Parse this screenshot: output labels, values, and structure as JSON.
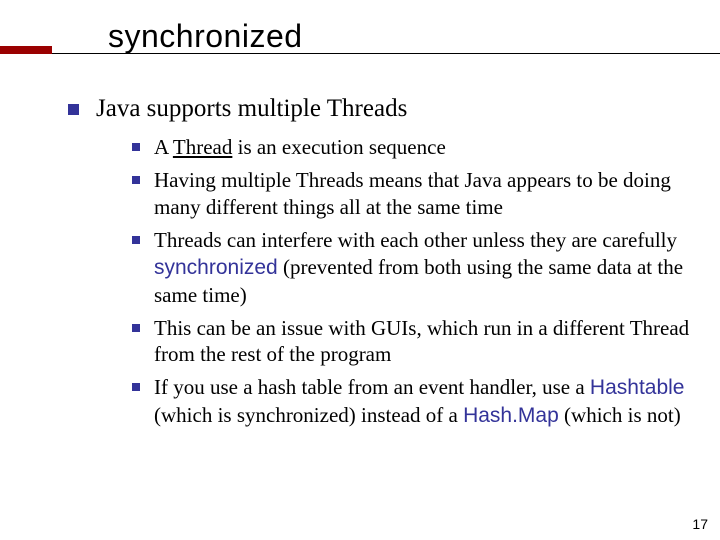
{
  "title": "synchronized",
  "main_bullet": "Java supports multiple Threads",
  "sub": [
    {
      "pre": "A ",
      "u": "Thread",
      "post": " is an execution sequence"
    },
    {
      "text": "Having multiple Threads means that Java appears to be doing many different things all at the same time"
    },
    {
      "pre": "Threads can interfere with each other unless they are carefully ",
      "code": "synchronized",
      "post": " (prevented from both using the same data at the same time)"
    },
    {
      "text": "This can be an issue with GUIs, which run in a different Thread from the rest of the program"
    },
    {
      "pre": "If you use a hash table from an event handler, use a ",
      "code": "Hashtable",
      "mid": " (which is synchronized) instead of a ",
      "code2": "Hash.Map",
      "post": " (which is not)"
    }
  ],
  "page_number": "17"
}
